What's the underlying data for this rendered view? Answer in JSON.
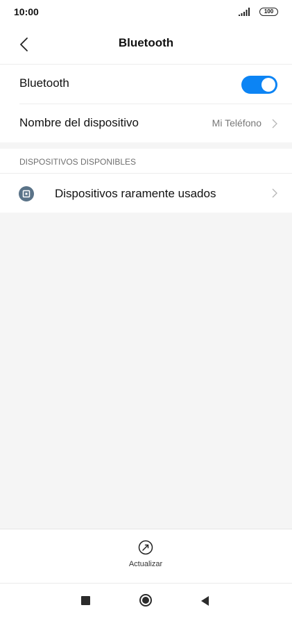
{
  "status_bar": {
    "time": "10:00",
    "battery": "100",
    "icons": [
      "signal-icon",
      "battery-icon"
    ]
  },
  "header": {
    "title": "Bluetooth",
    "back_icon": "chevron-left-icon"
  },
  "settings": {
    "bluetooth": {
      "label": "Bluetooth",
      "enabled": true,
      "toggle_color": "#0c84f4"
    },
    "device_name": {
      "label": "Nombre del dispositivo",
      "value": "Mi Teléfono",
      "icon": "chevron-right-icon"
    }
  },
  "available_devices": {
    "header": "DISPOSITIVOS DISPONIBLES",
    "items": [
      {
        "label": "Dispositivos raramente usados",
        "icon": "device-icon",
        "icon_color": "#5a7388"
      }
    ]
  },
  "bottom_action": {
    "label": "Actualizar",
    "icon": "refresh-icon"
  },
  "nav_bar": {
    "icons": [
      "recents-square-icon",
      "home-circle-icon",
      "back-triangle-icon"
    ]
  }
}
